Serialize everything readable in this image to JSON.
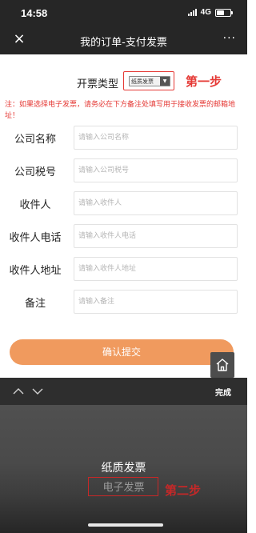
{
  "status_bar": {
    "time": "14:58",
    "network": "4G"
  },
  "nav": {
    "close_icon": "×",
    "title": "我的订单-支付发票",
    "more_icon": "···"
  },
  "invoice_type": {
    "label": "开票类型",
    "selected": "纸质发票",
    "step_annotation": "第一步"
  },
  "notice": "注：如果选择电子发票，请务必在下方备注处填写用于接收发票的邮箱地址！",
  "form": {
    "company_name": {
      "label": "公司名称",
      "placeholder": "请输入公司名称"
    },
    "tax_id": {
      "label": "公司税号",
      "placeholder": "请输入公司税号"
    },
    "recipient": {
      "label": "收件人",
      "placeholder": "请输入收件人"
    },
    "recipient_phone": {
      "label": "收件人电话",
      "placeholder": "请输入收件人电话"
    },
    "recipient_address": {
      "label": "收件人地址",
      "placeholder": "请输入收件人地址"
    },
    "remark": {
      "label": "备注",
      "placeholder": "请输入备注"
    }
  },
  "submit_label": "确认提交",
  "picker": {
    "done_label": "完成",
    "options": [
      "纸质发票",
      "电子发票"
    ],
    "step_annotation": "第二步"
  },
  "colors": {
    "accent": "#f09a5e",
    "annotation_red": "#e53935",
    "dark_bar": "#262626"
  }
}
